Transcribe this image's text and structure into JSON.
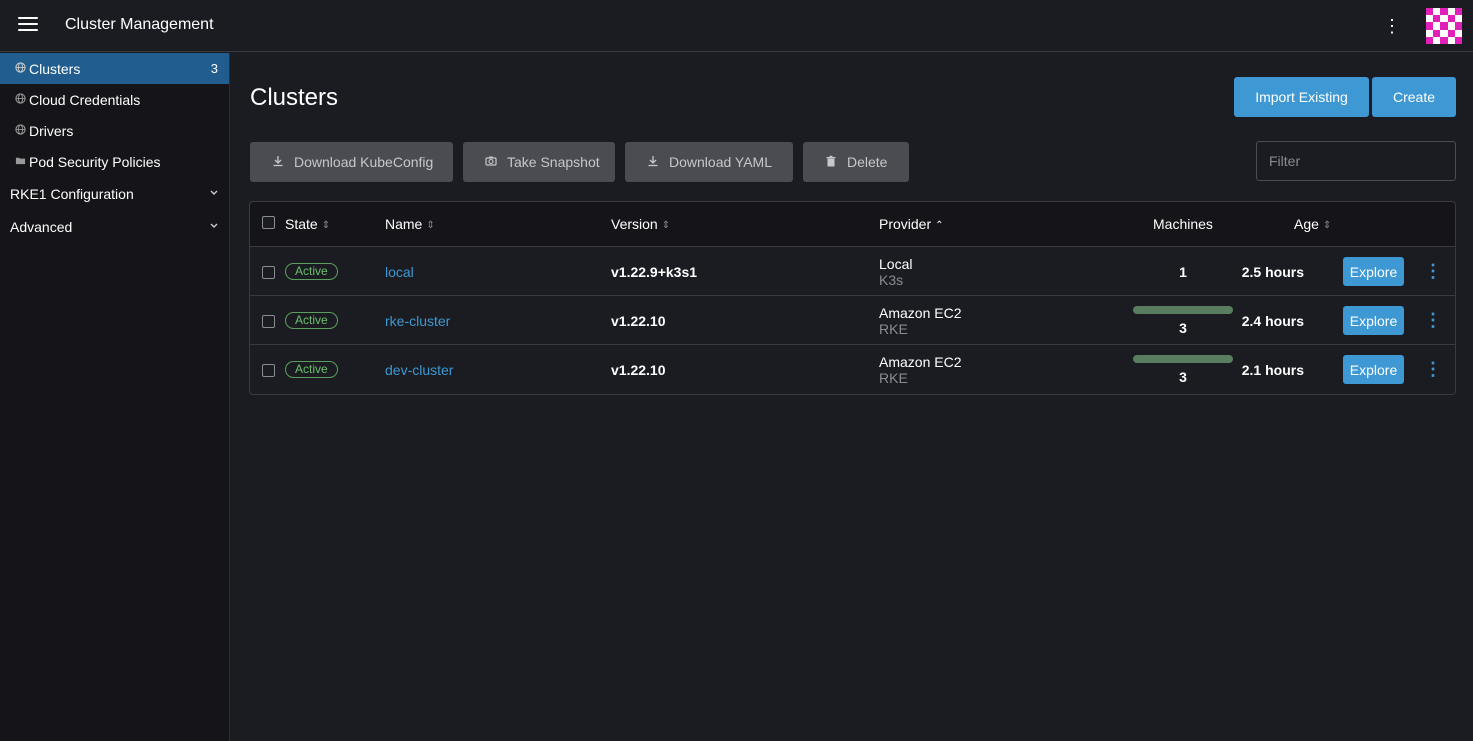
{
  "header": {
    "title": "Cluster Management"
  },
  "sidebar": {
    "items": [
      {
        "label": "Clusters",
        "count": "3",
        "icon": "globe-icon"
      },
      {
        "label": "Cloud Credentials",
        "icon": "globe-icon"
      },
      {
        "label": "Drivers",
        "icon": "globe-icon"
      },
      {
        "label": "Pod Security Policies",
        "icon": "folder-icon"
      }
    ],
    "groups": [
      {
        "label": "RKE1 Configuration"
      },
      {
        "label": "Advanced"
      }
    ]
  },
  "main": {
    "title": "Clusters",
    "import_label": "Import Existing",
    "create_label": "Create",
    "bulk": {
      "download_kubeconfig": "Download KubeConfig",
      "take_snapshot": "Take Snapshot",
      "download_yaml": "Download YAML",
      "delete": "Delete"
    },
    "filter_placeholder": "Filter"
  },
  "table": {
    "columns": [
      "State",
      "Name",
      "Version",
      "Provider",
      "Machines",
      "Age"
    ],
    "explore_label": "Explore",
    "rows": [
      {
        "state": "Active",
        "name": "local",
        "version": "v1.22.9+k3s1",
        "provider": "Local",
        "provider_sub": "K3s",
        "machines": "1",
        "machines_ready_fraction": null,
        "age": "2.5 hours"
      },
      {
        "state": "Active",
        "name": "rke-cluster",
        "version": "v1.22.10",
        "provider": "Amazon EC2",
        "provider_sub": "RKE",
        "machines": "3",
        "machines_ready_fraction": 1.0,
        "age": "2.4 hours"
      },
      {
        "state": "Active",
        "name": "dev-cluster",
        "version": "v1.22.10",
        "provider": "Amazon EC2",
        "provider_sub": "RKE",
        "machines": "3",
        "machines_ready_fraction": 1.0,
        "age": "2.1 hours"
      }
    ]
  },
  "colors": {
    "accent": "#3d98d3",
    "active_nav": "#215e8f",
    "status_active": "#6cbf6f",
    "machines_bar": "#5b7d5f"
  }
}
